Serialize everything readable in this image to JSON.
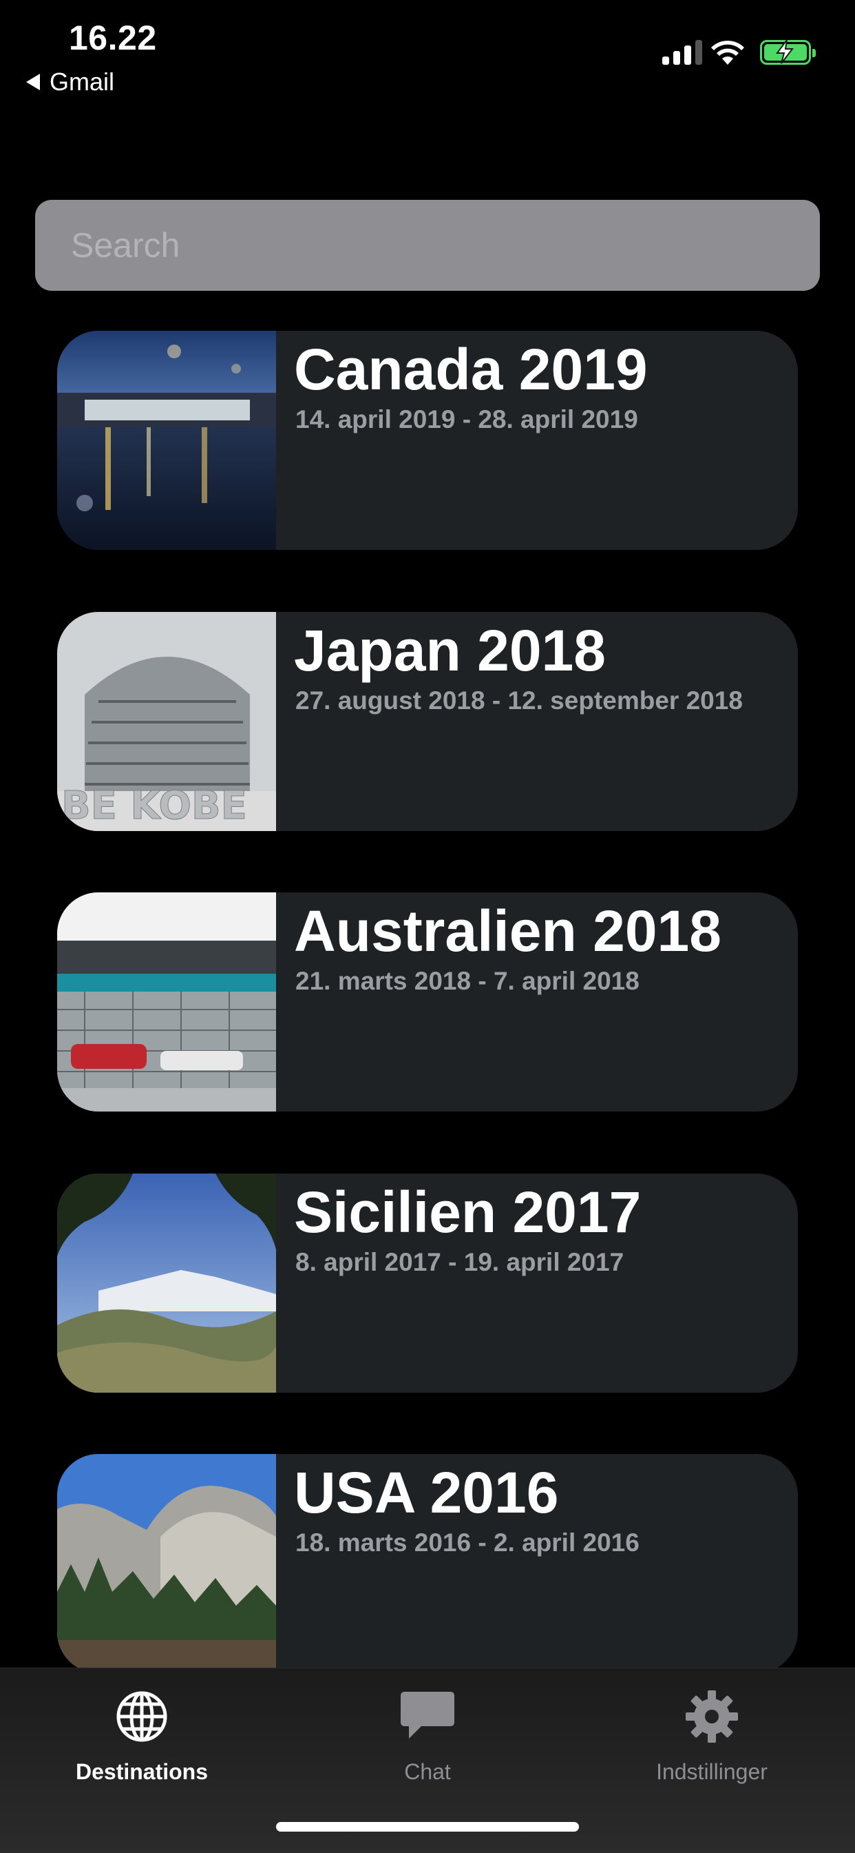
{
  "status_bar": {
    "time": "16.22",
    "back_label": "Gmail"
  },
  "search": {
    "placeholder": "Search",
    "value": ""
  },
  "trips": [
    {
      "title": "Canada 2019",
      "dates": "14. april 2019 - 28. april 2019",
      "thumbnail": "airport-rain-photo"
    },
    {
      "title": "Japan 2018",
      "dates": "27. august 2018 - 12. september 2018",
      "thumbnail": "kobe-hotel-photo"
    },
    {
      "title": "Australien 2018",
      "dates": "21. marts 2018 - 7. april 2018",
      "thumbnail": "melbourne-racetrack-photo"
    },
    {
      "title": "Sicilien 2017",
      "dates": "8. april 2017 - 19. april 2017",
      "thumbnail": "etna-landscape-photo"
    },
    {
      "title": "USA 2016",
      "dates": "18. marts 2016 - 2. april 2016",
      "thumbnail": "yosemite-cliff-photo"
    }
  ],
  "tab_bar": {
    "tabs": [
      {
        "label": "Destinations",
        "icon": "globe-icon",
        "active": true
      },
      {
        "label": "Chat",
        "icon": "chat-bubble-icon",
        "active": false
      },
      {
        "label": "Indstillinger",
        "icon": "gear-icon",
        "active": false
      }
    ]
  },
  "colors": {
    "accent_battery": "#4cd964",
    "card_bg": "#1f2225",
    "search_bg": "#8e8e93"
  }
}
